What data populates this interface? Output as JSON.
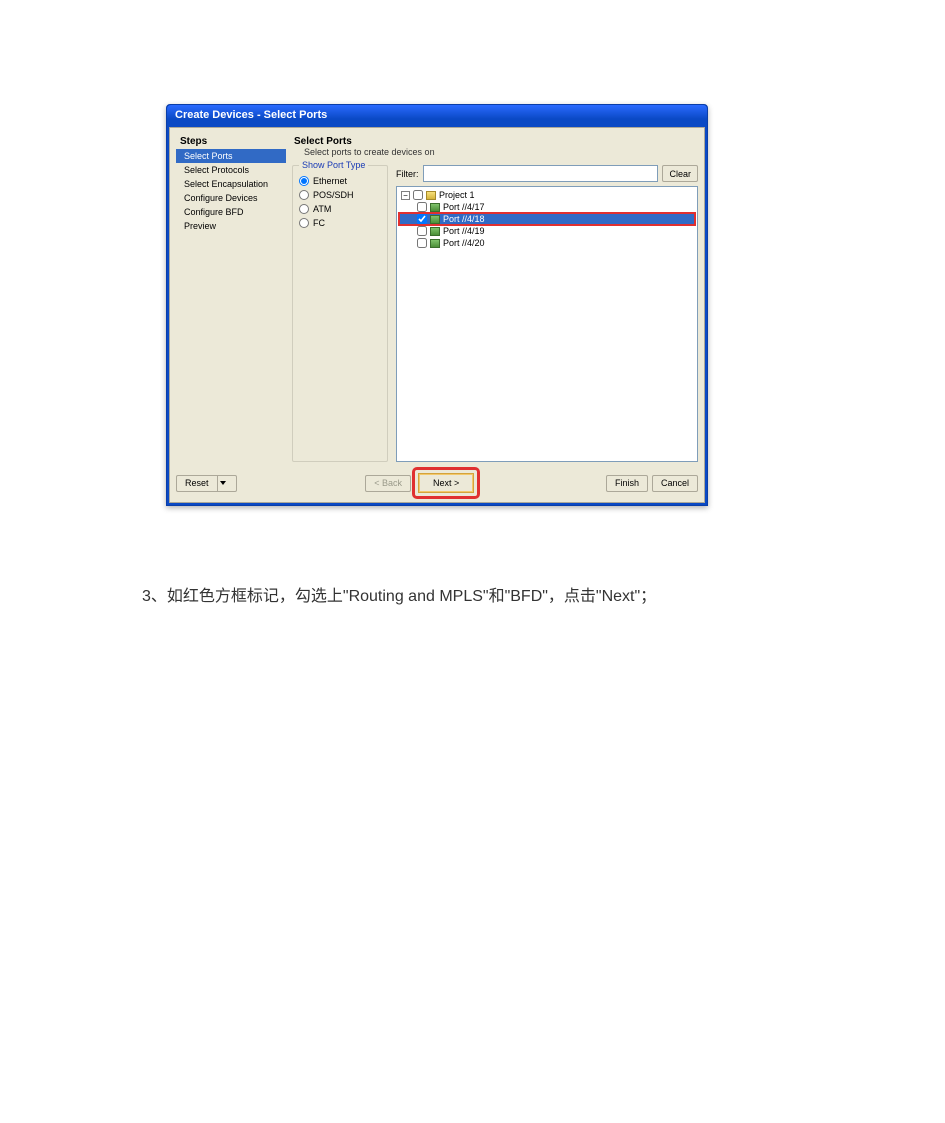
{
  "window": {
    "title": "Create Devices - Select Ports"
  },
  "steps": {
    "title": "Steps",
    "items": [
      {
        "label": "Select Ports",
        "active": true
      },
      {
        "label": "Select Protocols",
        "active": false
      },
      {
        "label": "Select Encapsulation",
        "active": false
      },
      {
        "label": "Configure Devices",
        "active": false
      },
      {
        "label": "Configure BFD",
        "active": false
      },
      {
        "label": "Preview",
        "active": false
      }
    ]
  },
  "header": {
    "title": "Select Ports",
    "sub": "Select ports to create devices on"
  },
  "port_type": {
    "legend": "Show Port Type",
    "options": [
      {
        "label": "Ethernet",
        "checked": true
      },
      {
        "label": "POS/SDH",
        "checked": false
      },
      {
        "label": "ATM",
        "checked": false
      },
      {
        "label": "FC",
        "checked": false
      }
    ]
  },
  "filter": {
    "label": "Filter:",
    "value": "",
    "clear": "Clear"
  },
  "tree": {
    "root": {
      "label": "Project 1",
      "checked": false
    },
    "ports": [
      {
        "label": "Port //4/17",
        "checked": false,
        "selected": false,
        "redbox": false
      },
      {
        "label": "Port //4/18",
        "checked": true,
        "selected": true,
        "redbox": true
      },
      {
        "label": "Port //4/19",
        "checked": false,
        "selected": false,
        "redbox": false
      },
      {
        "label": "Port //4/20",
        "checked": false,
        "selected": false,
        "redbox": false
      }
    ]
  },
  "buttons": {
    "reset": "Reset",
    "back": "< Back",
    "next": "Next >",
    "finish": "Finish",
    "cancel": "Cancel"
  },
  "caption": "3、如红色方框标记，勾选上\"Routing and MPLS\"和\"BFD\"，点击\"Next\"；"
}
